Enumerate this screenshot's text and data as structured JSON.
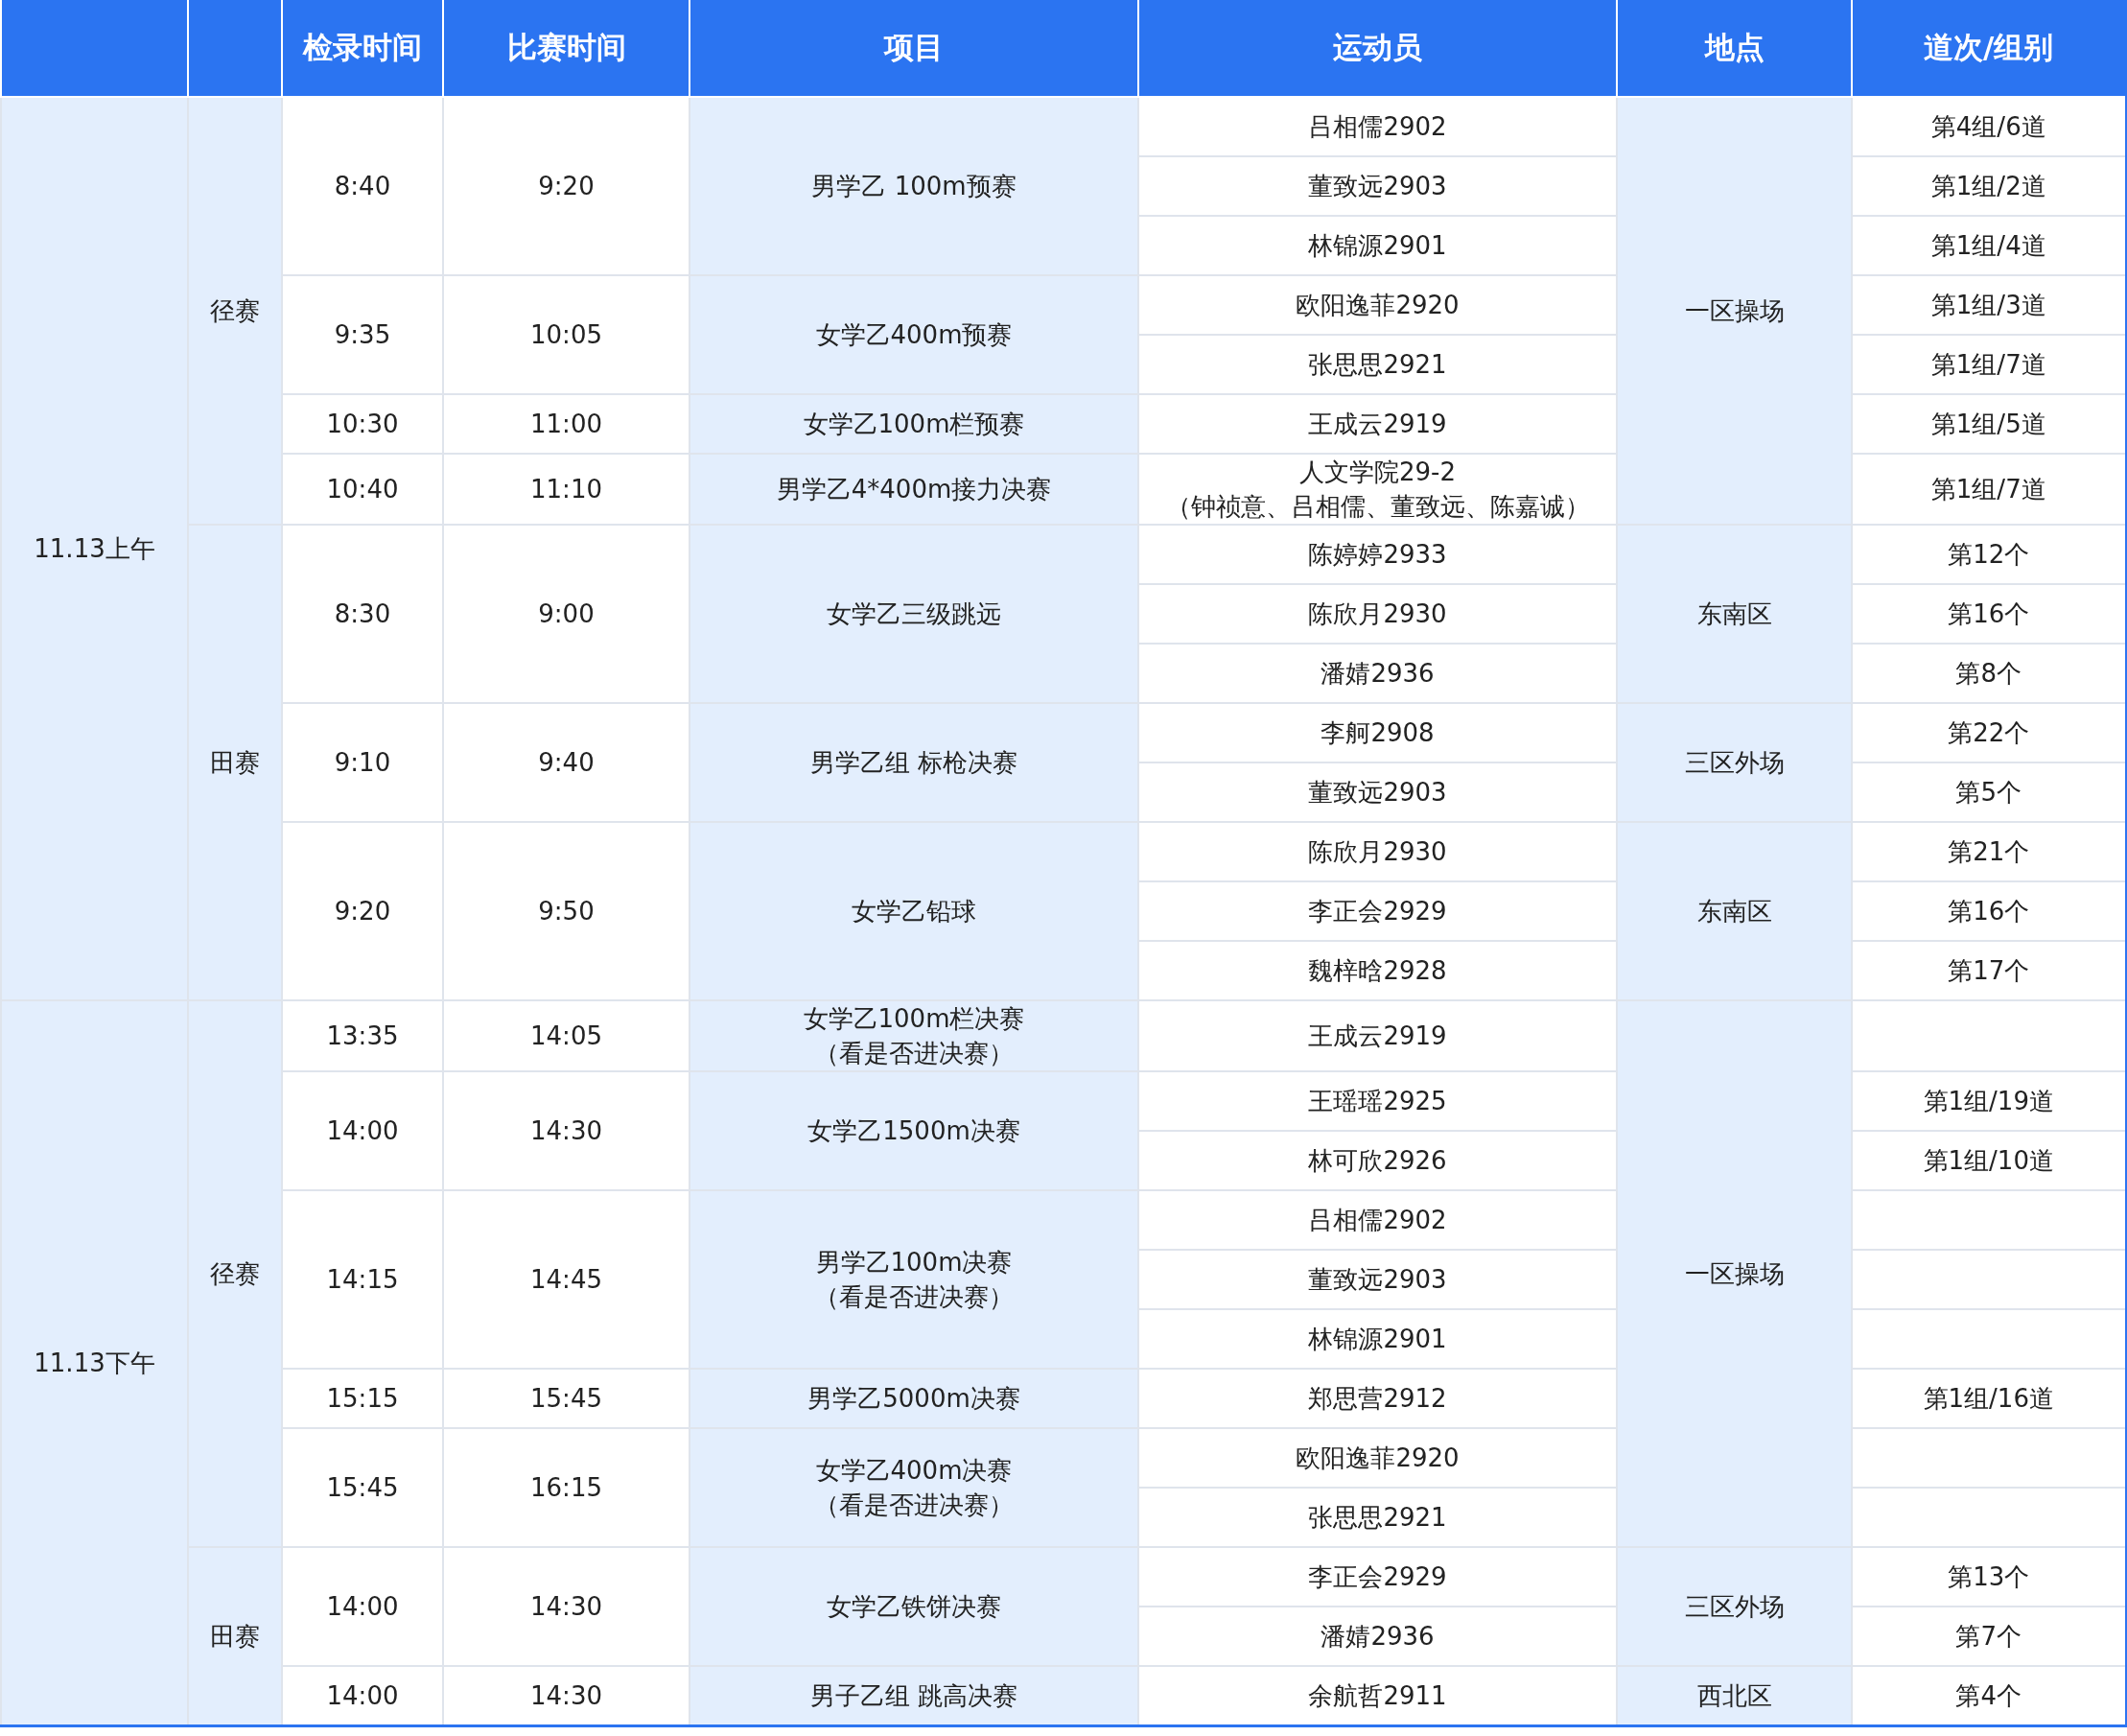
{
  "table": {
    "columns": [
      "检录时间",
      "比赛时间",
      "项目",
      "运动员",
      "地点",
      "道次/组别"
    ],
    "sessions": [
      {
        "label": "11.13上午",
        "categories": [
          {
            "label": "径赛",
            "venues": [
              {
                "name": "一区操场",
                "events": [
                  {
                    "checkin": "8:40",
                    "start": "9:20",
                    "name": "男学乙 100m预赛",
                    "athletes": [
                      {
                        "name": "吕相儒2902",
                        "lane": "第4组/6道"
                      },
                      {
                        "name": "董致远2903",
                        "lane": "第1组/2道"
                      },
                      {
                        "name": "林锦源2901",
                        "lane": "第1组/4道"
                      }
                    ]
                  },
                  {
                    "checkin": "9:35",
                    "start": "10:05",
                    "name": "女学乙400m预赛",
                    "athletes": [
                      {
                        "name": "欧阳逸菲2920",
                        "lane": "第1组/3道"
                      },
                      {
                        "name": "张思思2921",
                        "lane": "第1组/7道"
                      }
                    ]
                  },
                  {
                    "checkin": "10:30",
                    "start": "11:00",
                    "name": "女学乙100m栏预赛",
                    "athletes": [
                      {
                        "name": "王成云2919",
                        "lane": "第1组/5道"
                      }
                    ]
                  },
                  {
                    "checkin": "10:40",
                    "start": "11:10",
                    "name": "男学乙4*400m接力决赛",
                    "athletes": [
                      {
                        "name": "人文学院29-2",
                        "members": "（钟祯意、吕相儒、董致远、陈嘉诚）",
                        "lane": "第1组/7道"
                      }
                    ]
                  }
                ]
              }
            ]
          },
          {
            "label": "田赛",
            "venues": [
              {
                "name": "东南区",
                "events": [
                  {
                    "checkin": "8:30",
                    "start": "9:00",
                    "name": "女学乙三级跳远",
                    "athletes": [
                      {
                        "name": "陈婷婷2933",
                        "lane": "第12个"
                      },
                      {
                        "name": "陈欣月2930",
                        "lane": "第16个"
                      },
                      {
                        "name": "潘婧2936",
                        "lane": "第8个"
                      }
                    ]
                  }
                ]
              },
              {
                "name": "三区外场",
                "events": [
                  {
                    "checkin": "9:10",
                    "start": "9:40",
                    "name": "男学乙组 标枪决赛",
                    "athletes": [
                      {
                        "name": "李舸2908",
                        "lane": "第22个"
                      },
                      {
                        "name": "董致远2903",
                        "lane": "第5个"
                      }
                    ]
                  }
                ]
              },
              {
                "name": "东南区",
                "events": [
                  {
                    "checkin": "9:20",
                    "start": "9:50",
                    "name": "女学乙铅球",
                    "athletes": [
                      {
                        "name": "陈欣月2930",
                        "lane": "第21个"
                      },
                      {
                        "name": "李正会2929",
                        "lane": "第16个"
                      },
                      {
                        "name": "魏梓晗2928",
                        "lane": "第17个"
                      }
                    ]
                  }
                ]
              }
            ]
          }
        ]
      },
      {
        "label": "11.13下午",
        "categories": [
          {
            "label": "径赛",
            "venues": [
              {
                "name": "一区操场",
                "events": [
                  {
                    "checkin": "13:35",
                    "start": "14:05",
                    "name": "女学乙100m栏决赛",
                    "note": "（看是否进决赛）",
                    "athletes": [
                      {
                        "name": "王成云2919"
                      }
                    ]
                  },
                  {
                    "checkin": "14:00",
                    "start": "14:30",
                    "name": "女学乙1500m决赛",
                    "athletes": [
                      {
                        "name": "王瑶瑶2925",
                        "lane": "第1组/19道"
                      },
                      {
                        "name": "林可欣2926",
                        "lane": "第1组/10道"
                      }
                    ]
                  },
                  {
                    "checkin": "14:15",
                    "start": "14:45",
                    "name": "男学乙100m决赛",
                    "note": "（看是否进决赛）",
                    "athletes": [
                      {
                        "name": "吕相儒2902"
                      },
                      {
                        "name": "董致远2903"
                      },
                      {
                        "name": "林锦源2901"
                      }
                    ]
                  },
                  {
                    "checkin": "15:15",
                    "start": "15:45",
                    "name": "男学乙5000m决赛",
                    "athletes": [
                      {
                        "name": "郑思营2912",
                        "lane": "第1组/16道"
                      }
                    ]
                  },
                  {
                    "checkin": "15:45",
                    "start": "16:15",
                    "name": "女学乙400m决赛",
                    "note": "（看是否进决赛）",
                    "athletes": [
                      {
                        "name": "欧阳逸菲2920"
                      },
                      {
                        "name": "张思思2921"
                      }
                    ]
                  }
                ]
              }
            ]
          },
          {
            "label": "田赛",
            "venues": [
              {
                "name": "三区外场",
                "events": [
                  {
                    "checkin": "14:00",
                    "start": "14:30",
                    "name": "女学乙铁饼决赛",
                    "athletes": [
                      {
                        "name": "李正会2929",
                        "lane": "第13个"
                      },
                      {
                        "name": "潘婧2936",
                        "lane": "第7个"
                      }
                    ]
                  }
                ]
              },
              {
                "name": "西北区",
                "events": [
                  {
                    "checkin": "14:00",
                    "start": "14:30",
                    "name": "男子乙组 跳高决赛",
                    "athletes": [
                      {
                        "name": "余航哲2911",
                        "lane": "第4个"
                      }
                    ]
                  }
                ]
              }
            ]
          }
        ]
      }
    ]
  }
}
